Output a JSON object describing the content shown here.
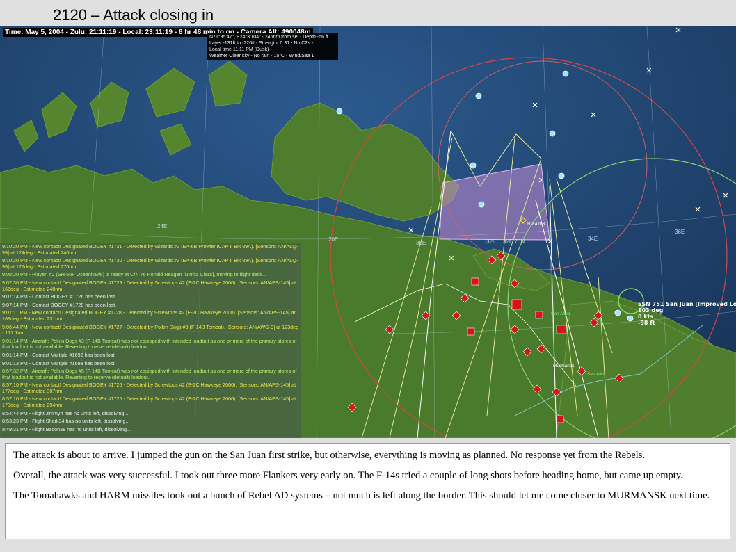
{
  "slide": {
    "title": "2120 – Attack closing in"
  },
  "map": {
    "status_bar": "Time: May 5, 2004 - Zulu: 21:11:19 - Local: 23:11:19 - 8 hr 48 min to go -  Camera Alt: 490048m",
    "info_box": [
      "N71°35'47\", E24°30'04\" - 246nm from sel - Depth -56 ft",
      "Layer -131ft to -226ft - Strength: 0.31 - No CZs -",
      "Local time 11:11 PM (Dusk)",
      "Weather Clear sky - No rain - 15°C - Wind/Sea 1"
    ],
    "longitude_labels": [
      "24E",
      "30E",
      "32E",
      "32E 70N",
      "34E",
      "36E",
      "20E"
    ],
    "unit_label": {
      "name": "SSN 751 San Juan [Improved Los",
      "heading": "103 deg",
      "speed": "0 kts",
      "depth": "-98 ft"
    },
    "map_labels": {
      "rp": "RP 4763",
      "base1": "San Alloc",
      "base2": "San Allo",
      "murmansk": "Murmansk"
    },
    "colors": {
      "sea": "#1f3f6b",
      "land": "#4c7a2a",
      "zone_fill": "#c88ed6",
      "hostile": "#d01818",
      "friendly": "#9ee6ff",
      "range_ring": "#d04848",
      "route": "#e8e89a"
    }
  },
  "message_log": [
    {
      "text": "9:10:20 PM - New contact! Designated BOGEY #1731 - Detected by Wizards #2 (EA-6B Prowler ICAP II Blk 89A). [Sensors: AN/ALQ-99] at 174deg - Estimated 240nm",
      "color": "c-yellow"
    },
    {
      "text": "9:10:20 PM - New contact! Designated BOGEY #1730 - Detected by Wizards #2 (EA-6B Prowler ICAP II Blk 89A). [Sensors: AN/ALQ-99] at 177deg - Estimated 270nm",
      "color": "c-yellow"
    },
    {
      "text": "9:08:20 PM - Player: #2 (SH-60F Oceanhawk) is ready at C/N 76 Ronald Reagan [Nimitz Class], moving to flight deck...",
      "color": "c-lgreen"
    },
    {
      "text": "9:07:36 PM - New contact! Designated BOGEY #1729 - Detected by Screwtops #2 (E-2C Hawkeye 2000). [Sensors: AN/APS-145] at 166deg - Estimated 240nm",
      "color": "c-yellow"
    },
    {
      "text": "9:07:14 PM - Contact BOGEY #1726 has been lost.",
      "color": "c-white"
    },
    {
      "text": "9:07:14 PM - Contact BOGEY #1728 has been lost.",
      "color": "c-white"
    },
    {
      "text": "9:07:11 PM - New contact! Designated BOGEY #1728 - Detected by Screwtops #2 (E-2C Hawkeye 2000). [Sensors: AN/APS-145] at 169deg - Estimated 231nm",
      "color": "c-yellow"
    },
    {
      "text": "9:06:44 PM - New contact! Designated BOGEY #1727 - Detected by Polkin Dogs #3 (F-14B Tomcat). [Sensors: AN/AWG-9] at 123deg - 177.1nm",
      "color": "c-yellow"
    },
    {
      "text": "9:01:14 PM - Aircraft: Polkin Dogs #3 (F-14B Tomcat) was not equipped with intended loadout as one or more of the primary stores of that loadout is not available. Reverting to reserve (default) loadout.",
      "color": "c-lgreen"
    },
    {
      "text": "9:01:14 PM - Contact Multiple #1692 has been lost.",
      "color": "c-white"
    },
    {
      "text": "9:01:13 PM - Contact Multiple #1693 has been lost.",
      "color": "c-white"
    },
    {
      "text": "8:57:32 PM - Aircraft: Polkin Dogs #5 (F-14B Tomcat) was not equipped with intended loadout as one or more of the primary stores of that loadout is not available. Reverting to reserve (default) loadout.",
      "color": "c-lgreen"
    },
    {
      "text": "8:57:10 PM - New contact! Designated BOGEY #1726 - Detected by Screwtops #2 (E-2C Hawkeye 2000). [Sensors: AN/APS-145] at 177deg - Estimated 307nm",
      "color": "c-yellow"
    },
    {
      "text": "8:57:10 PM - New contact! Designated BOGEY #1725 - Detected by Screwtops #2 (E-2C Hawkeye 2000). [Sensors: AN/APS-145] at 173deg - Estimated 294nm",
      "color": "c-yellow"
    },
    {
      "text": "8:54:44 PM - Flight Jimmy4 has no units left, dissolving...",
      "color": "c-white"
    },
    {
      "text": "8:53:23 PM - Flight Shark34 has no units left, dissolving...",
      "color": "c-white"
    },
    {
      "text": "8:49:31 PM - Flight Bacon38 has no units left, dissolving...",
      "color": "c-white"
    }
  ],
  "narrative": [
    "The attack is about to arrive.  I jumped the gun on the San Juan first strike, but otherwise, everything is moving as planned.  No response yet from the Rebels.",
    "Overall, the attack was very successful.  I took out three more Flankers very early on.  The F-14s tried a couple of long shots before heading home, but came up empty.",
    "The Tomahawks and HARM missiles took out a bunch of Rebel AD systems – not much is left along the border.  This should let me come closer to MURMANSK next time."
  ]
}
